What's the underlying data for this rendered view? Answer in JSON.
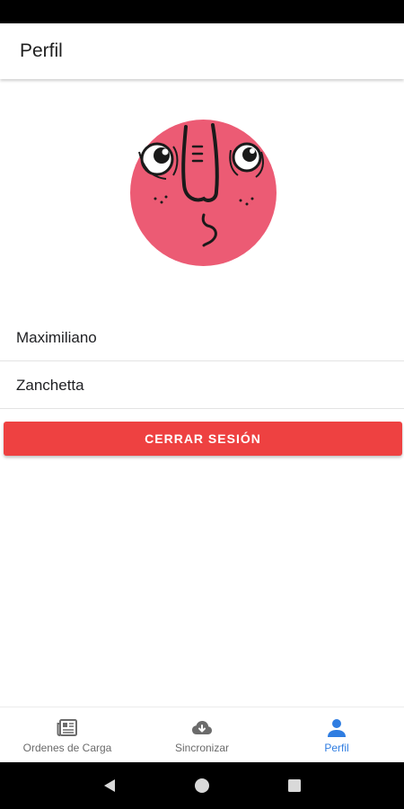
{
  "app_bar": {
    "title": "Perfil"
  },
  "profile": {
    "avatar_icon": "cartoon-face-avatar",
    "avatar_color": "#ec5b74",
    "first_name": "Maximiliano",
    "last_name": "Zanchetta"
  },
  "actions": {
    "logout_label": "CERRAR SESIÓN",
    "logout_color": "#ee4141"
  },
  "bottom_nav": {
    "items": [
      {
        "label": "Ordenes de Carga",
        "icon": "newspaper-icon",
        "active": false
      },
      {
        "label": "Sincronizar",
        "icon": "cloud-download-icon",
        "active": false
      },
      {
        "label": "Perfil",
        "icon": "person-icon",
        "active": true
      }
    ],
    "active_color": "#2f7de1",
    "inactive_color": "#6b6b6b"
  },
  "system_nav": {
    "icons": [
      "back-icon",
      "home-icon",
      "recents-icon"
    ]
  }
}
